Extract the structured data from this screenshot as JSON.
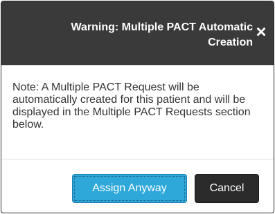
{
  "dialog": {
    "title": "Warning: Multiple PACT Automatic Creation",
    "close_icon": "close-x-icon",
    "message": "Note: A Multiple PACT Request will be automatically created for this patient and will be displayed in the Multiple PACT Requests section below.",
    "buttons": {
      "assign_anyway": "Assign Anyway",
      "cancel": "Cancel"
    }
  },
  "colors": {
    "header_bg": "#3a3a3a",
    "primary_button": "#2ea7d9",
    "cancel_button": "#2b2b2b"
  }
}
